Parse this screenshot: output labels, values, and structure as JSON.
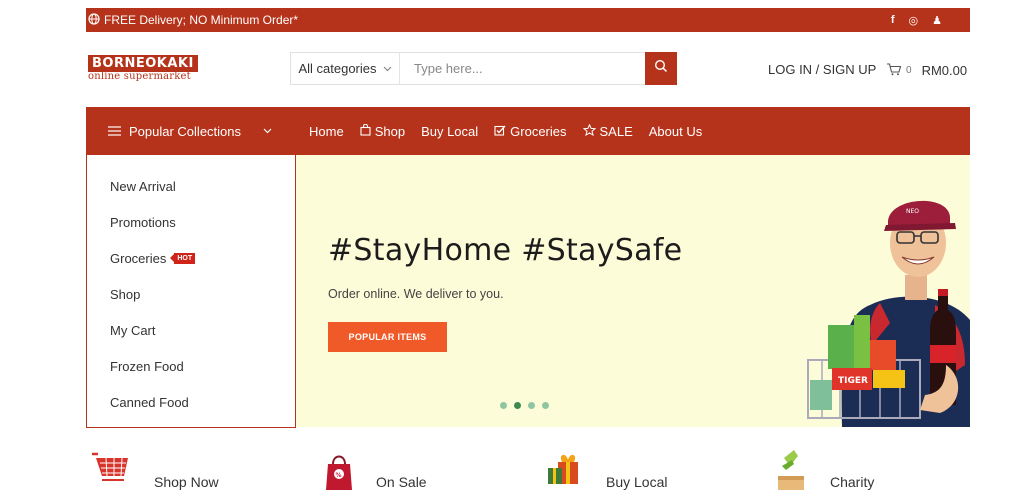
{
  "topbar": {
    "promo": "FREE Delivery; NO Minimum Order*",
    "social": [
      "f",
      "◎",
      "♟"
    ]
  },
  "logo": {
    "main": "BORNEOKAKI",
    "sub": "online supermarket"
  },
  "search": {
    "category": "All categories",
    "placeholder": "Type here..."
  },
  "account": {
    "login": "LOG IN / SIGN UP"
  },
  "cart": {
    "count": "0",
    "total": "RM0.00"
  },
  "nav": {
    "collections": "Popular Collections",
    "links": [
      {
        "label": "Home",
        "icon": ""
      },
      {
        "label": "Shop",
        "icon": "shopping-bag-icon"
      },
      {
        "label": "Buy Local",
        "icon": ""
      },
      {
        "label": "Groceries",
        "icon": "checkbox-icon"
      },
      {
        "label": "SALE",
        "icon": "star-icon"
      },
      {
        "label": "About Us",
        "icon": ""
      }
    ]
  },
  "sidemenu": {
    "items": [
      "New Arrival",
      "Promotions",
      "Groceries",
      "Shop",
      "My Cart",
      "Frozen Food",
      "Canned Food"
    ],
    "hot_badge": "HOT"
  },
  "banner": {
    "headline": "#StayHome #StaySafe",
    "subline": "Order online. We deliver to you.",
    "cta": "POPULAR ITEMS",
    "slides": 4,
    "active_slide": 2
  },
  "features": [
    {
      "label": "Shop Now",
      "icon": "shopping-cart-icon"
    },
    {
      "label": "On Sale",
      "icon": "sale-bag-icon"
    },
    {
      "label": "Buy Local",
      "icon": "gift-icon"
    },
    {
      "label": "Charity",
      "icon": "charity-box-icon"
    }
  ],
  "colors": {
    "brand": "#b5331a",
    "cta": "#f05a28",
    "banner_bg": "#fdfcd8"
  }
}
